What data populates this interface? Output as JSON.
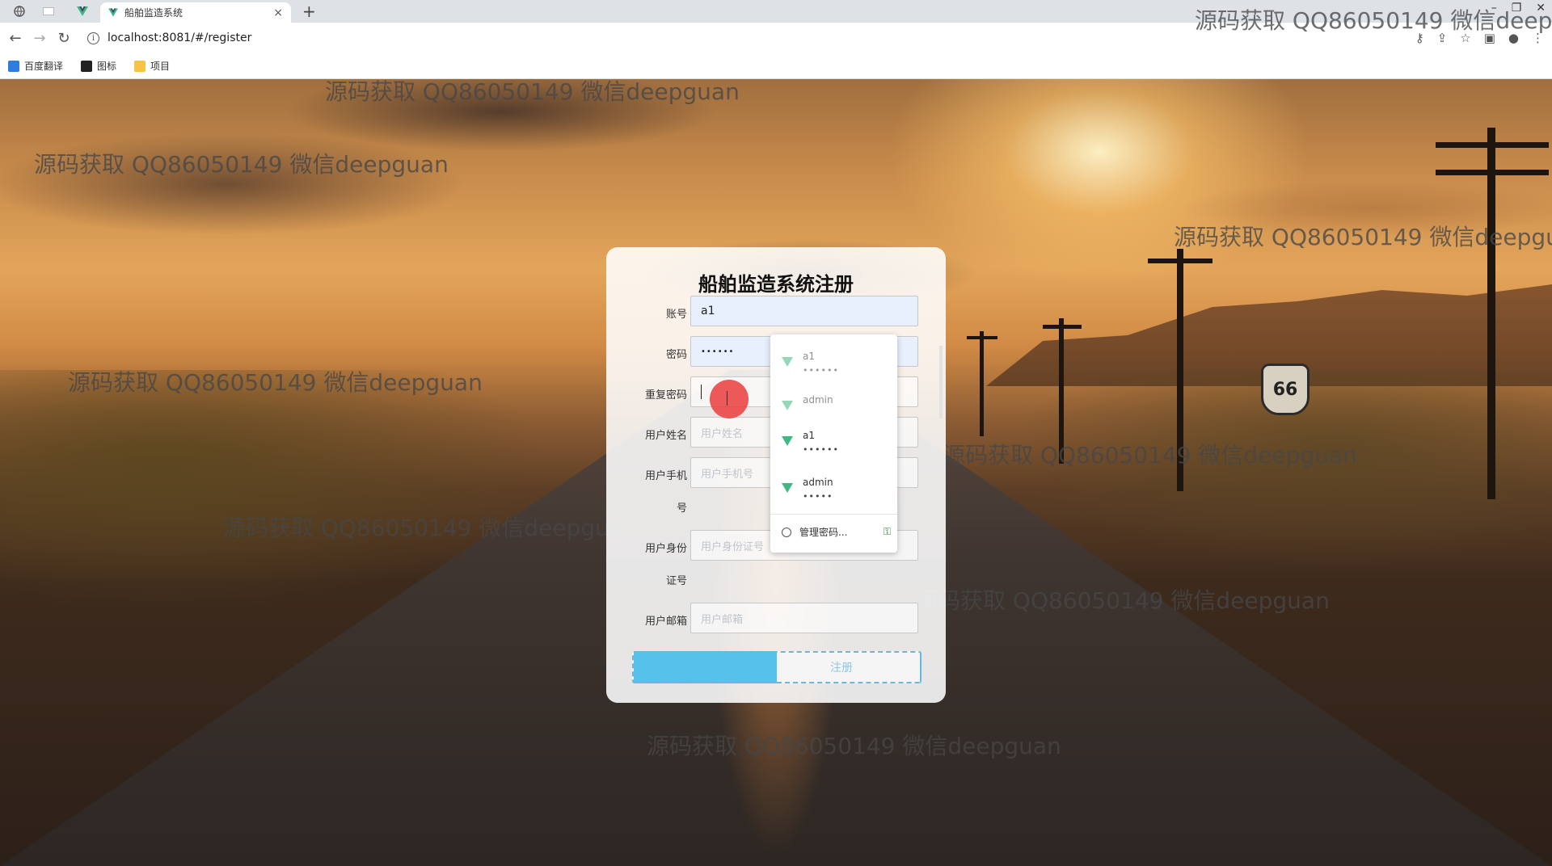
{
  "browser": {
    "tab_title": "船舶监造系统",
    "tab_close": "×",
    "new_tab": "+",
    "url": "localhost:8081/#/register",
    "bookmarks": [
      {
        "label": "百度翻译",
        "color": "#2f7de1"
      },
      {
        "label": "图标",
        "color": "#222222"
      },
      {
        "label": "项目",
        "color": "#f6c343"
      }
    ]
  },
  "form": {
    "title": "船舶监造系统注册",
    "fields": [
      {
        "label": "账号",
        "value": "a1",
        "placeholder": ""
      },
      {
        "label": "密码",
        "value": "••••••",
        "placeholder": ""
      },
      {
        "label": "重复密码",
        "value": "",
        "placeholder": ""
      },
      {
        "label": "用户姓名",
        "value": "",
        "placeholder": "用户姓名"
      },
      {
        "label": "用户手机",
        "label2": "号",
        "value": "",
        "placeholder": "用户手机号"
      },
      {
        "label": "用户身份",
        "label2": "证号",
        "value": "",
        "placeholder": "用户身份证号"
      },
      {
        "label": "用户邮箱",
        "value": "",
        "placeholder": "用户邮箱"
      }
    ],
    "submit_label": "注册"
  },
  "autofill": {
    "items": [
      {
        "user": "a1",
        "pass": "••••••"
      },
      {
        "user": "admin",
        "pass": ""
      },
      {
        "user": "a1",
        "pass": "••••••"
      },
      {
        "user": "admin",
        "pass": "•••••"
      }
    ],
    "manage_label": "管理密码...",
    "key_icon": "key-icon"
  },
  "watermarks": [
    "源码获取 QQ86050149 微信deepguan"
  ],
  "road_sign": "66",
  "colors": {
    "vue_green": "#41b883",
    "submit_blue": "#56c1ea",
    "click_marker": "#eb3c3c"
  }
}
